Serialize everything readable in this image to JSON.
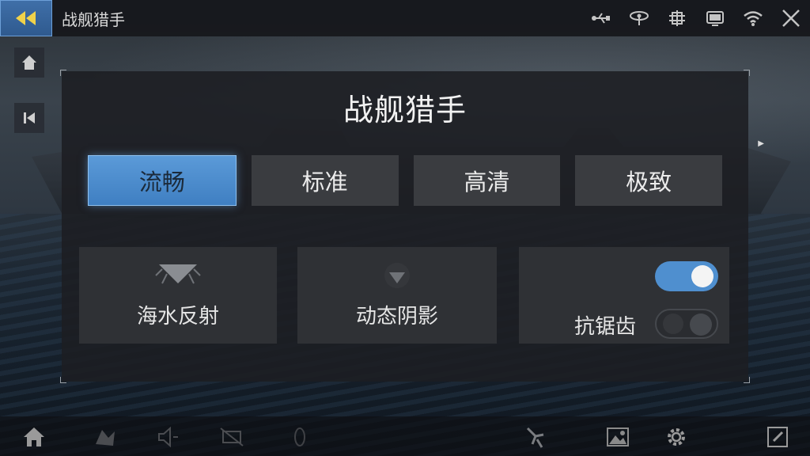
{
  "topbar": {
    "title": "战舰猎手",
    "icons": [
      "usb-icon",
      "signal-antenna-icon",
      "settings-gear-icon",
      "screen-icon",
      "wifi-icon",
      "close-icon"
    ]
  },
  "panel": {
    "title": "战舰猎手",
    "quality_options": [
      {
        "label": "流畅",
        "selected": true
      },
      {
        "label": "标准",
        "selected": false
      },
      {
        "label": "高清",
        "selected": false
      },
      {
        "label": "极致",
        "selected": false
      }
    ],
    "options": {
      "water_reflection": "海水反射",
      "dynamic_shadow": "动态阴影",
      "anti_aliasing": "抗锯齿"
    },
    "toggles": {
      "top_toggle_on": true,
      "anti_aliasing_on": false
    }
  },
  "colors": {
    "accent": "#4f8fcf",
    "panel_bg": "#1c1e22",
    "button_bg": "#3a3c40"
  }
}
